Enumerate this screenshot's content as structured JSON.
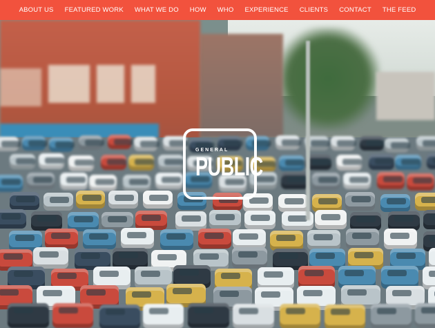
{
  "nav": {
    "items": [
      {
        "label": "ABOUT US"
      },
      {
        "label": "FEATURED WORK"
      },
      {
        "label": "WHAT WE DO"
      },
      {
        "label": "HOW"
      },
      {
        "label": "WHO"
      },
      {
        "label": "EXPERIENCE"
      },
      {
        "label": "CLIENTS"
      },
      {
        "label": "CONTACT"
      },
      {
        "label": "THE FEED"
      }
    ]
  },
  "logo": {
    "line1": "GENERAL",
    "line2": "PUBLIC"
  },
  "colors": {
    "nav_bg": "#f2523d",
    "nav_text": "#ffffff",
    "logo": "#ffffff"
  }
}
